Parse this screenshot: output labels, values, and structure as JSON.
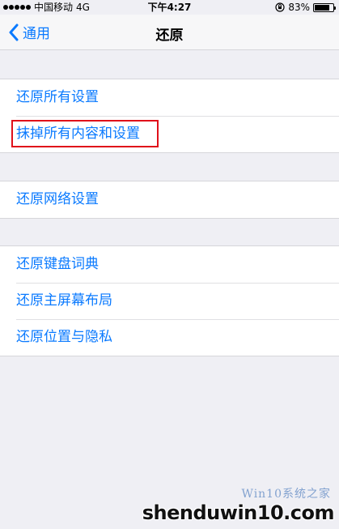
{
  "status_bar": {
    "carrier": "中国移动",
    "network": "4G",
    "time": "下午4:27",
    "battery_percent": "83%",
    "battery_level": 0.83
  },
  "nav": {
    "back_label": "通用",
    "title": "还原"
  },
  "groups": [
    {
      "items": [
        "还原所有设置",
        "抹掉所有内容和设置"
      ]
    },
    {
      "items": [
        "还原网络设置"
      ]
    },
    {
      "items": [
        "还原键盘词典",
        "还原主屏幕布局",
        "还原位置与隐私"
      ]
    }
  ],
  "watermark": {
    "line1": "Win10系统之家",
    "line2": "shenduwin10.com"
  },
  "colors": {
    "accent": "#0a7aff",
    "highlight_box": "#e0101a",
    "background": "#efeff4"
  }
}
